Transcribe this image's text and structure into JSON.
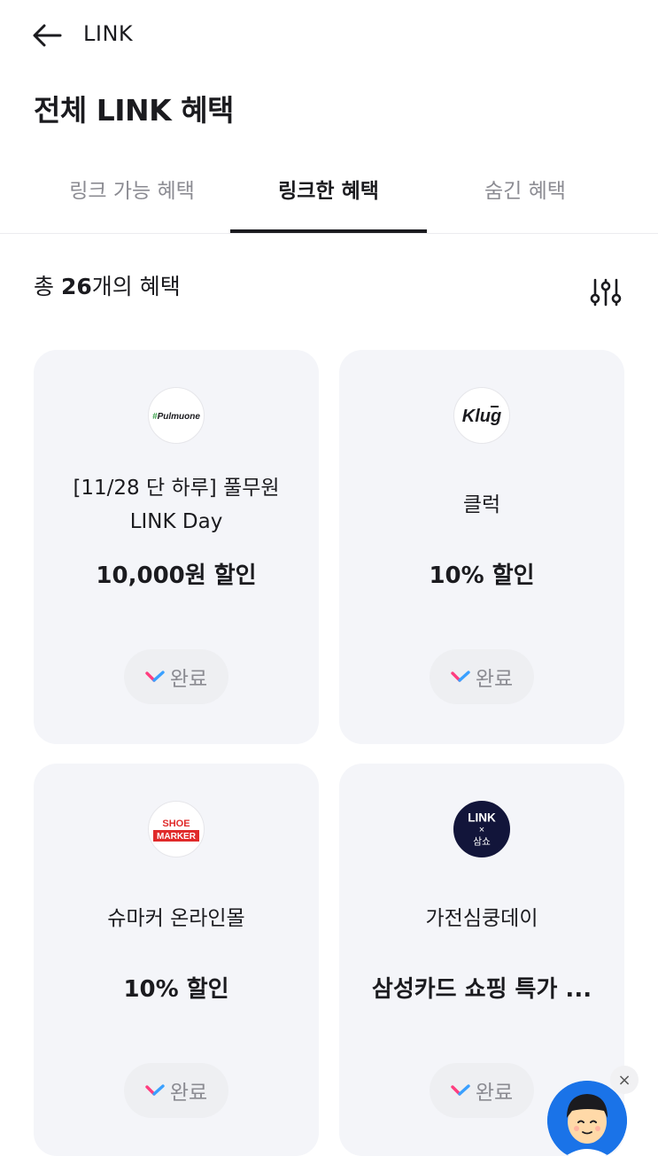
{
  "header": {
    "title": "LINK",
    "back_icon": "arrow-left-icon"
  },
  "page": {
    "title": "전체 LINK 혜택"
  },
  "tabs": [
    {
      "label": "링크 가능 혜택",
      "active": false
    },
    {
      "label": "링크한 혜택",
      "active": true
    },
    {
      "label": "숨긴 혜택",
      "active": false
    }
  ],
  "summary": {
    "prefix": "총 ",
    "count": "26",
    "suffix": "개의 혜택",
    "filter_icon": "sliders-icon"
  },
  "cards": [
    {
      "logo_text": "Pulmuone",
      "name_line1": "[11/28 단 하루] 풀무원",
      "name_line2": "LINK Day",
      "benefit": "10,000원 할인",
      "status": "완료"
    },
    {
      "logo_text": "Klug",
      "name_line1": "클럭",
      "name_line2": "",
      "benefit": "10% 할인",
      "status": "완료"
    },
    {
      "logo_text_1": "SHOE",
      "logo_text_2": "MARKER",
      "name_line1": "슈마커 온라인몰",
      "name_line2": "",
      "benefit": "10% 할인",
      "status": "완료"
    },
    {
      "logo_text_1": "LINK",
      "logo_text_2": "×",
      "logo_text_3": "삼쇼",
      "name_line1": "가전심쿵데이",
      "name_line2": "",
      "benefit": "삼성카드 쇼핑 특가 ...",
      "status": "완료"
    }
  ],
  "colors": {
    "card_bg": "#f4f5f9",
    "check_pink": "#ff3d7f",
    "check_blue": "#3aa0ff",
    "chat_bg": "#1a73e8"
  },
  "chat_widget": {
    "close_label": "×"
  }
}
